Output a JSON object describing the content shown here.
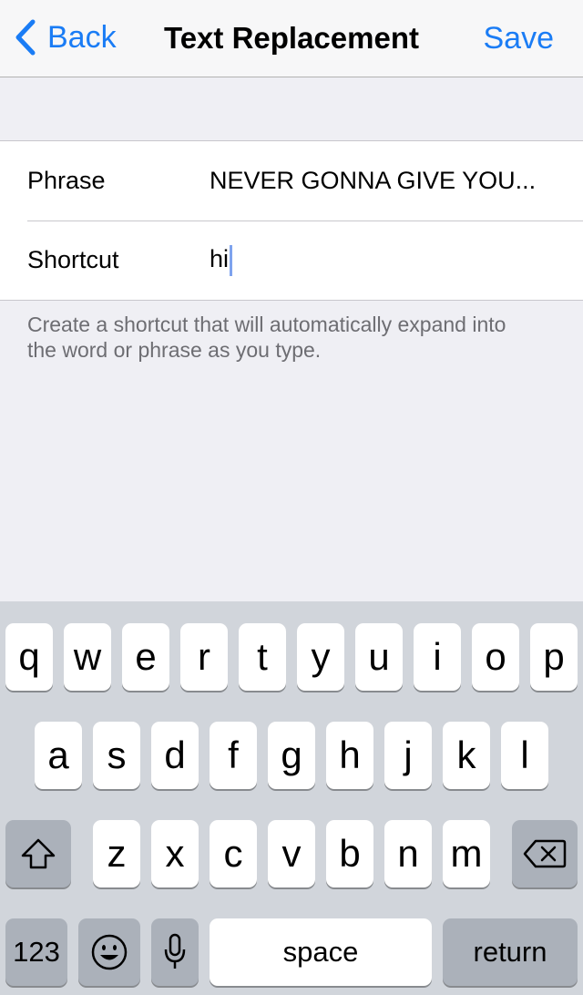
{
  "nav": {
    "back_label": "Back",
    "title": "Text Replacement",
    "save_label": "Save",
    "accent_color": "#1a7cf5"
  },
  "form": {
    "phrase_label": "Phrase",
    "phrase_value": "NEVER GONNA GIVE YOU...",
    "shortcut_label": "Shortcut",
    "shortcut_value": "hi"
  },
  "footer_text": "Create a shortcut that will automatically expand into the word or phrase as you type.",
  "keyboard": {
    "row1": [
      "q",
      "w",
      "e",
      "r",
      "t",
      "y",
      "u",
      "i",
      "o",
      "p"
    ],
    "row2": [
      "a",
      "s",
      "d",
      "f",
      "g",
      "h",
      "j",
      "k",
      "l"
    ],
    "row3": [
      "z",
      "x",
      "c",
      "v",
      "b",
      "n",
      "m"
    ],
    "numbers_label": "123",
    "space_label": "space",
    "return_label": "return",
    "icons": [
      "chevron-left-icon",
      "shift-icon",
      "delete-icon",
      "emoji-icon",
      "microphone-icon"
    ]
  }
}
